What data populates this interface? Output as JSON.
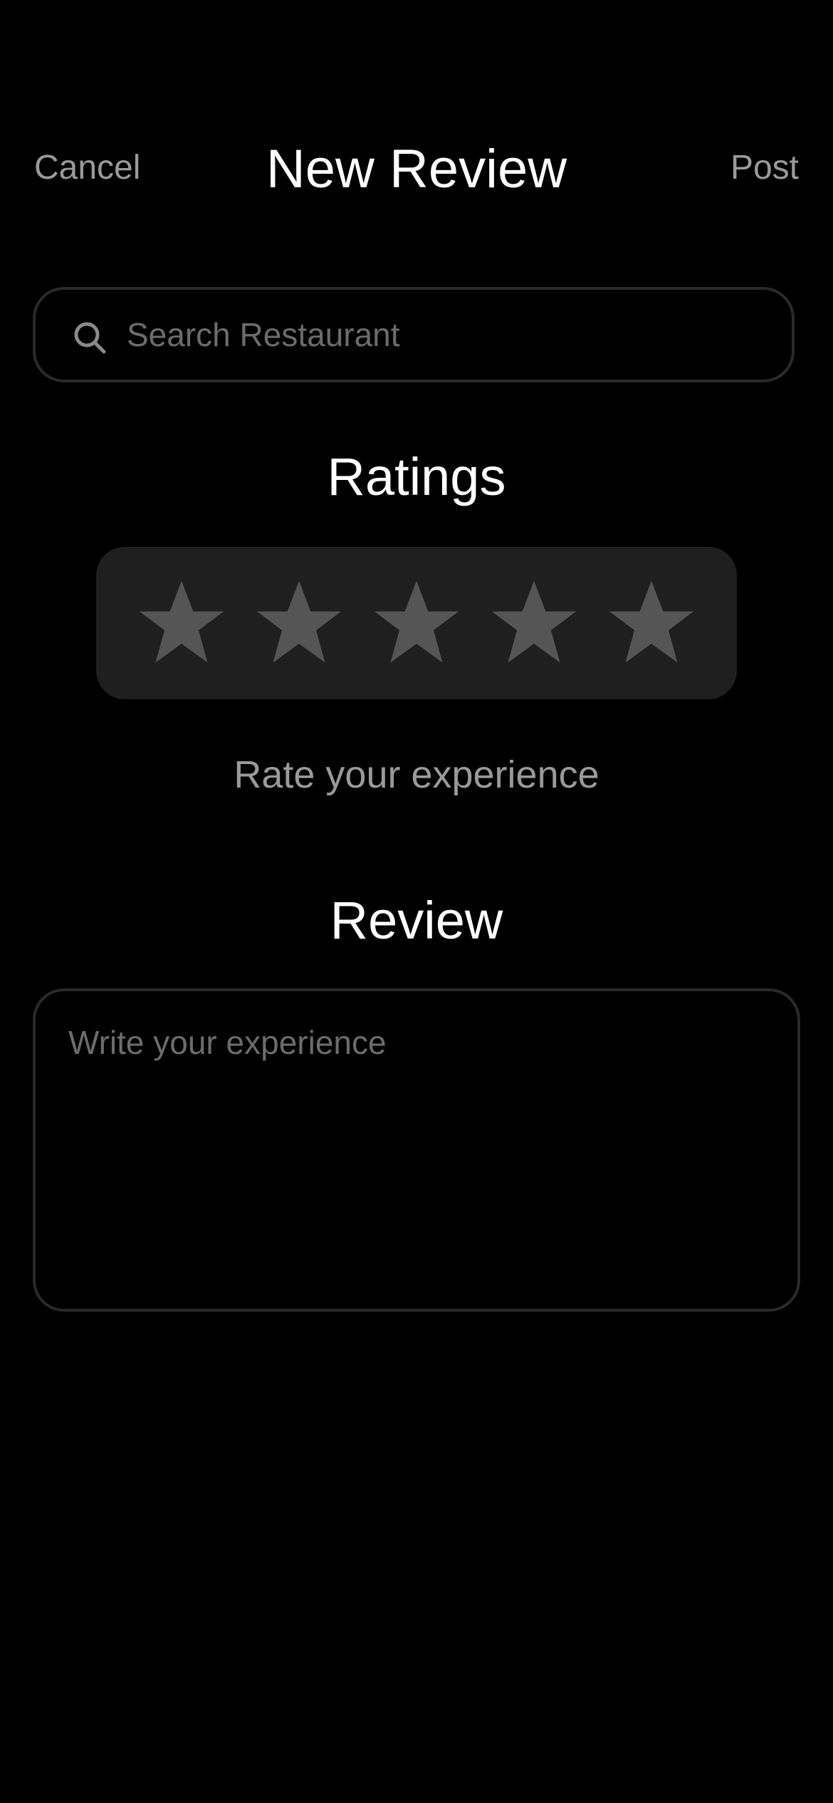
{
  "nav": {
    "cancel_label": "Cancel",
    "title": "New Review",
    "post_label": "Post"
  },
  "search": {
    "placeholder": "Search Restaurant",
    "value": "",
    "icon": "search-icon"
  },
  "ratings": {
    "heading": "Ratings",
    "max_stars": 5,
    "selected": 0,
    "star_icon": "star-icon",
    "caption": "Rate your experience"
  },
  "review": {
    "heading": "Review",
    "placeholder": "Write your experience",
    "value": ""
  },
  "colors": {
    "background": "#000000",
    "star_inactive": "#555555",
    "panel": "#1f1f1f",
    "muted_text": "#9a9a9a",
    "placeholder": "#6c6c6c",
    "border": "#2a2a2a"
  }
}
